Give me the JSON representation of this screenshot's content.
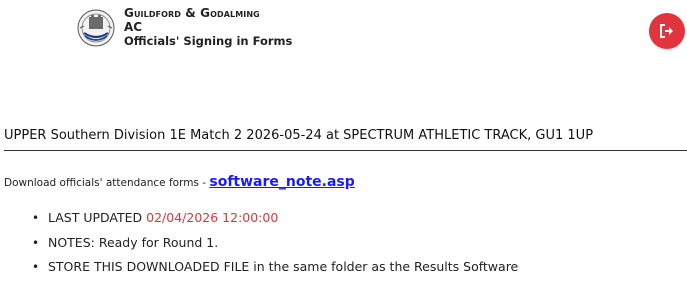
{
  "header": {
    "club_name_line1": "Guildford & Godalming",
    "club_name_line2": "AC",
    "subtitle": "Officials' Signing in Forms",
    "logo_icon": "club-crest-icon",
    "logout_icon": "sign-out-icon",
    "logout_color": "#e0353c"
  },
  "match": {
    "title": "UPPER Southern Division 1E Match 2 2026-05-24 at SPECTRUM ATHLETIC TRACK, GU1 1UP"
  },
  "download": {
    "prefix": "Download officials' attendance forms - ",
    "link_text": "software_note.asp"
  },
  "notes": {
    "last_updated_label": "LAST UPDATED ",
    "last_updated_value": "02/04/2026 12:00:00",
    "notes_text": "NOTES: Ready for Round 1.",
    "store_text": "STORE THIS DOWNLOADED FILE in the same folder as the Results Software",
    "highlight_color": "#e0353c"
  }
}
